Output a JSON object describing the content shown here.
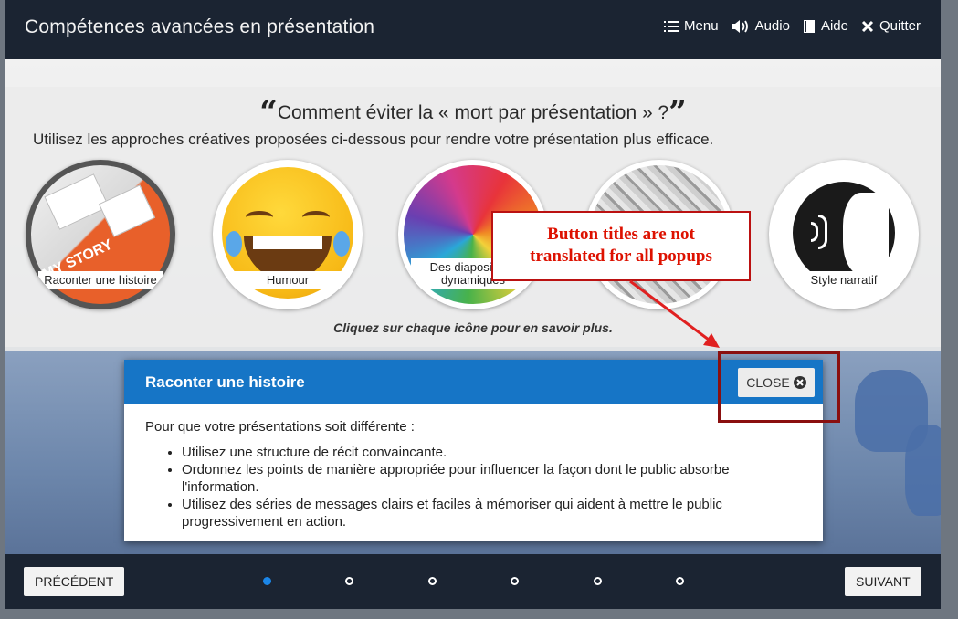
{
  "app": {
    "title": "Compétences avancées en présentation"
  },
  "topnav": {
    "menu": "Menu",
    "audio": "Audio",
    "help": "Aide",
    "quit": "Quitter"
  },
  "slide": {
    "title": "Comment éviter la « mort par présentation » ?",
    "subtitle": "Utilisez les approches créatives proposées ci-dessous pour rendre votre présentation plus efficace.",
    "hint": "Cliquez sur chaque icône pour en savoir plus.",
    "circles": [
      {
        "label": "Raconter une histoire",
        "icon": "story-keyboard-icon"
      },
      {
        "label": "Humour",
        "icon": "laughing-emoji-icon"
      },
      {
        "label": "Des diapositives dynamiques",
        "icon": "colorful-swirl-icon"
      },
      {
        "label": "",
        "icon": "maze-icon"
      },
      {
        "label": "Style narratif",
        "icon": "speaking-head-icon"
      }
    ]
  },
  "popup": {
    "title": "Raconter une histoire",
    "close_label": "CLOSE",
    "intro": "Pour que votre présentations soit différente :",
    "bullets": [
      "Utilisez une structure de récit convaincante.",
      "Ordonnez les points de manière appropriée pour influencer la façon dont le public absorbe l'information.",
      "Utilisez des séries de messages clairs et faciles à mémoriser qui aident à mettre le public progressivement en action."
    ]
  },
  "footer": {
    "prev": "PRÉCÉDENT",
    "next": "SUIVANT",
    "page_count": 6,
    "current_page": 1
  },
  "annotation": {
    "text_line1": "Button titles are not",
    "text_line2": "translated for all popups"
  },
  "colors": {
    "header": "#1b2432",
    "popup_header": "#1675c6",
    "active_dot": "#1b86e8",
    "annotation": "#b11111"
  }
}
